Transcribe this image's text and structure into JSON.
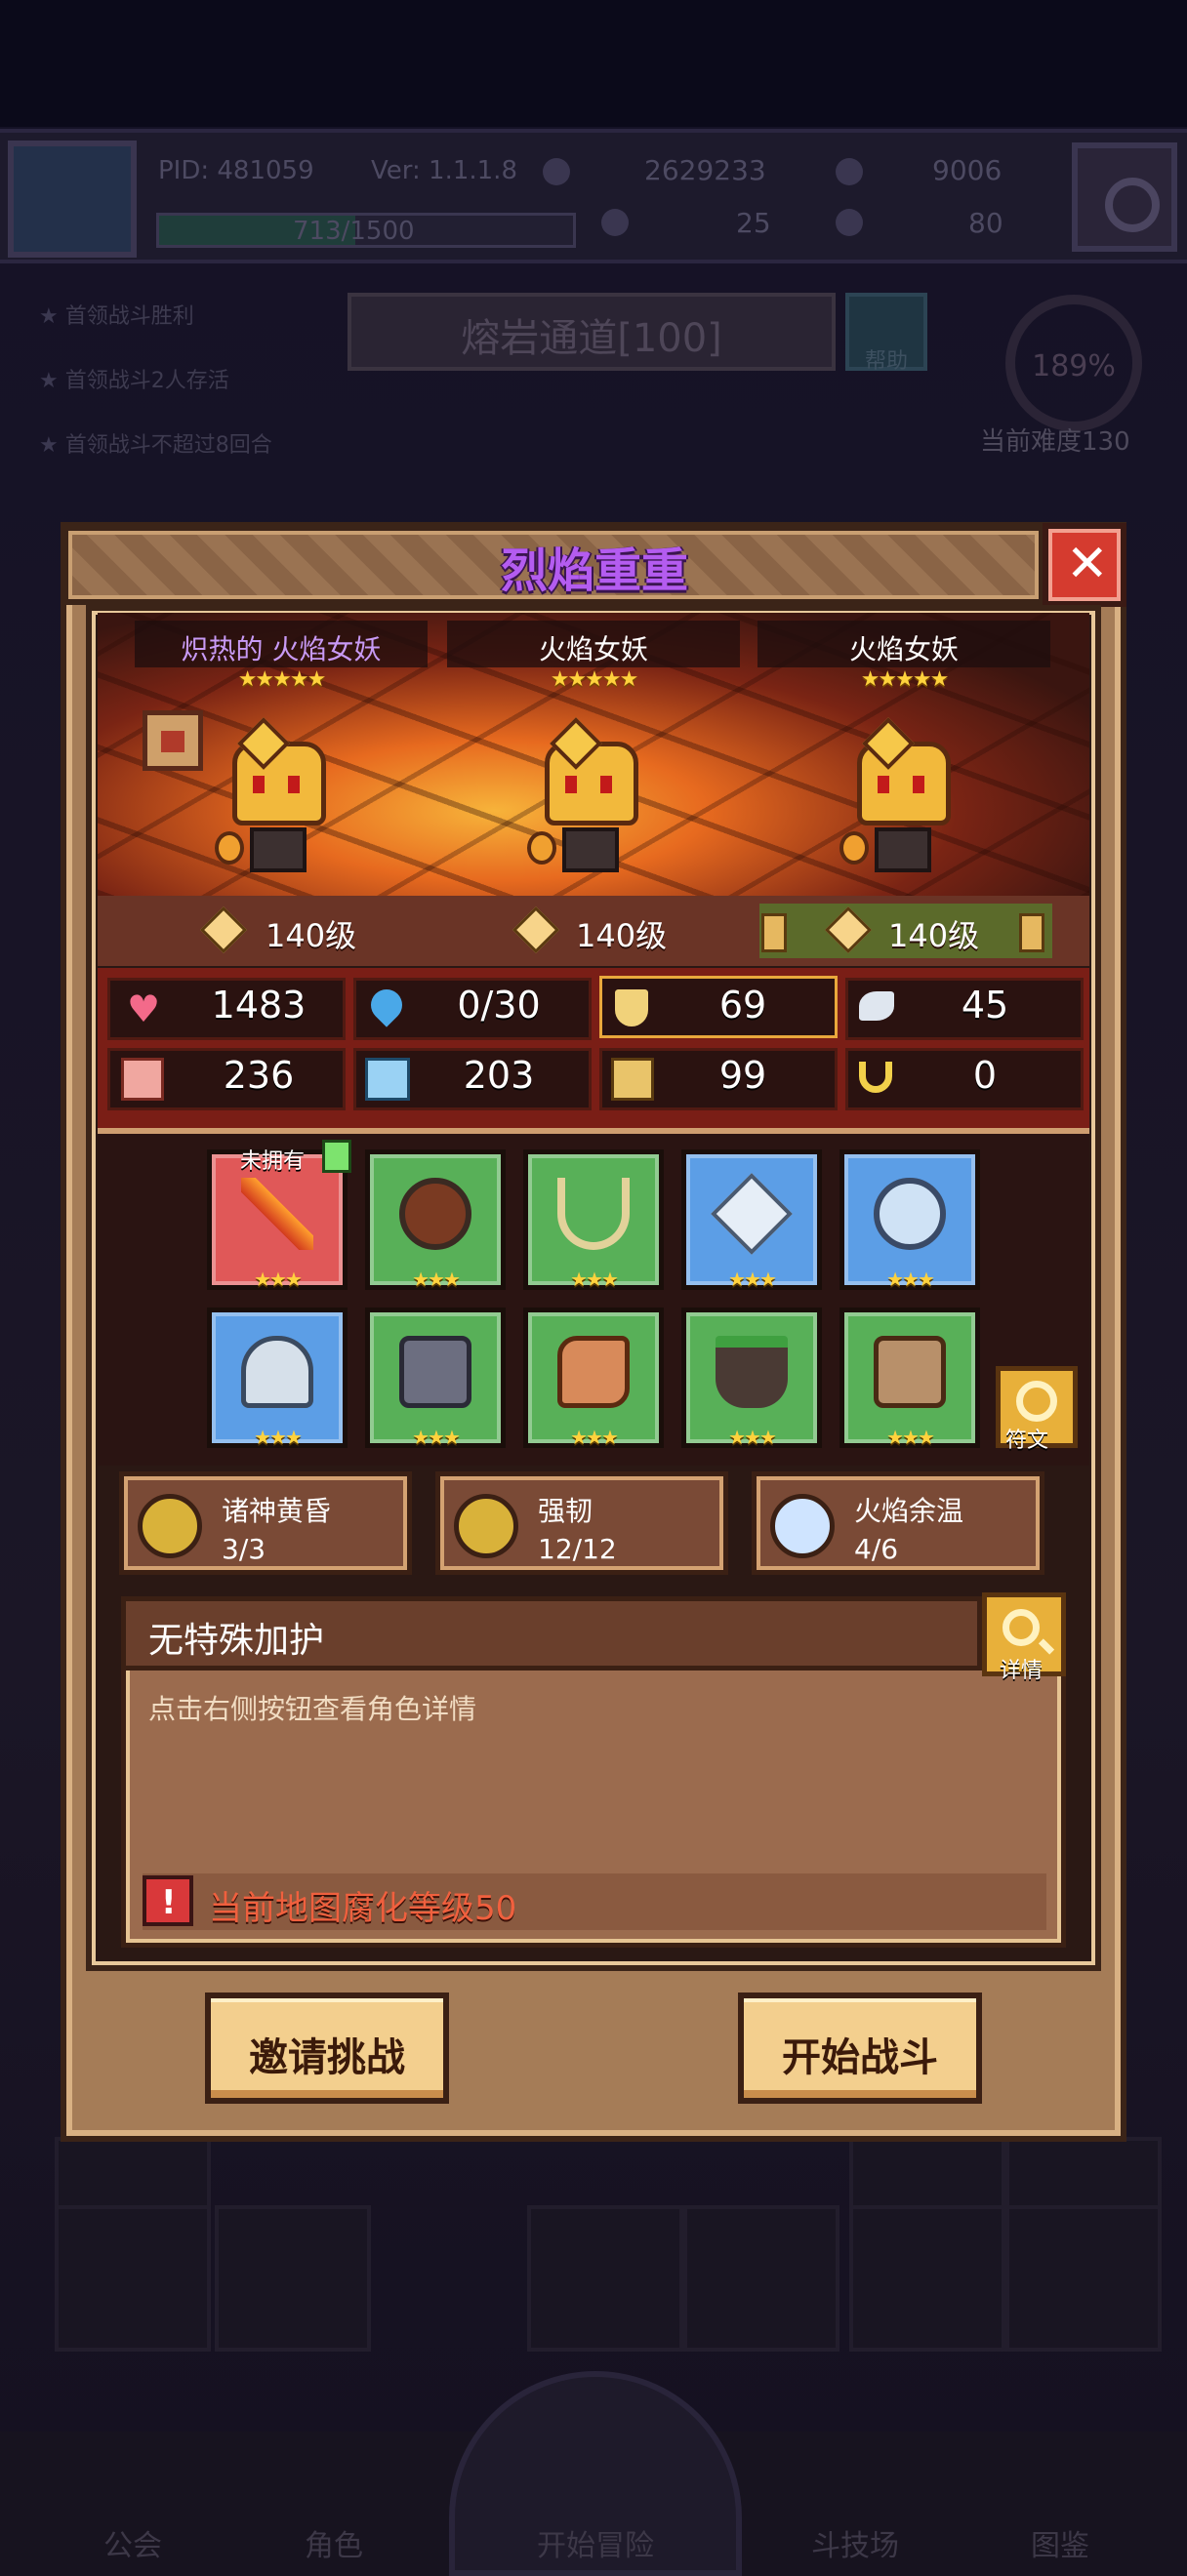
{
  "background": {
    "pid": "PID: 481059",
    "version": "Ver: 1.1.1.8",
    "exp": "713/1500",
    "exp_fraction": 0.475,
    "resources": [
      "2629233",
      "9006",
      "25",
      "80"
    ],
    "quests": [
      "首领战斗胜利",
      "首领战斗2人存活",
      "首领战斗不超过8回合"
    ],
    "stage_name": "熔岩通道[100]",
    "help_label": "帮助",
    "difficulty_percent": "189%",
    "difficulty_label": "当前难度130",
    "nav": [
      "公会",
      "角色",
      "开始冒险",
      "斗技场",
      "图鉴"
    ]
  },
  "modal": {
    "title": "烈焰重重",
    "close_icon": "close-icon"
  },
  "enemies": [
    {
      "name": "炽热的 火焰女妖",
      "stars": "★★★★★",
      "level": "140级",
      "highlight": true
    },
    {
      "name": "火焰女妖",
      "stars": "★★★★★",
      "level": "140级",
      "highlight": false
    },
    {
      "name": "火焰女妖",
      "stars": "★★★★★",
      "level": "140级",
      "highlight": false
    }
  ],
  "stats": {
    "hp": "1483",
    "mana": "0/30",
    "defense": "69",
    "speed": "45",
    "attack": "236",
    "magic": "203",
    "armor": "99",
    "crit": "0"
  },
  "gear": {
    "unowned_label": "未拥有",
    "stars": "★★★",
    "rune_label": "符文"
  },
  "sets": [
    {
      "name": "诸神黄昏",
      "count": "3/3",
      "color": "#d9b23a"
    },
    {
      "name": "强韧",
      "count": "12/12",
      "color": "#d9b23a"
    },
    {
      "name": "火焰余温",
      "count": "4/6",
      "color": "#cfe4ff"
    }
  ],
  "description": {
    "title": "无特殊加护",
    "detail_label": "详情",
    "text": "点击右侧按钮查看角色详情",
    "warning": "当前地图腐化等级50"
  },
  "buttons": {
    "invite": "邀请挑战",
    "start": "开始战斗"
  }
}
